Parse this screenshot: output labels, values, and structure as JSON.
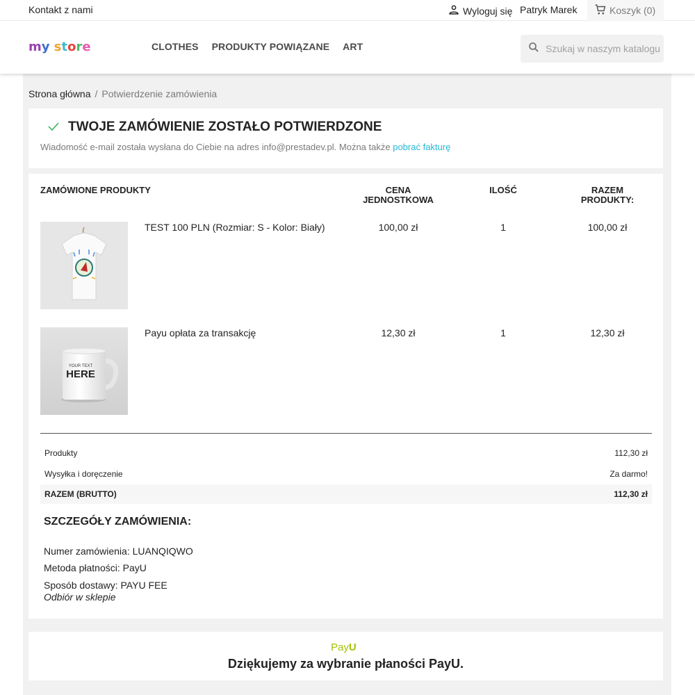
{
  "topbar": {
    "contact": "Kontakt z nami",
    "logout": "Wyloguj się",
    "user": "Patryk Marek",
    "cart": "Koszyk (0)"
  },
  "header": {
    "logo": [
      "m",
      "y",
      " ",
      "s",
      "t",
      "o",
      "r",
      "e"
    ],
    "logo_colors": [
      "#9b3fae",
      "#3c6fce",
      "#ffffff",
      "#f3a331",
      "#3eb8d6",
      "#e4423a",
      "#4cbb6c",
      "#e45ab2"
    ],
    "nav": [
      "CLOTHES",
      "PRODUKTY POWIĄZANE",
      "ART"
    ],
    "search_placeholder": "Szukaj w naszym katalogu"
  },
  "breadcrumb": {
    "home": "Strona główna",
    "separator": "/",
    "current": "Potwierdzenie zamówienia"
  },
  "confirmation": {
    "title": "TWOJE ZAMÓWIENIE ZOSTAŁO POTWIERDZONE",
    "message": "Wiadomość e-mail została wysłana do Ciebie na adres info@prestadev.pl. Można także",
    "invoice_link": "pobrać fakturę"
  },
  "order": {
    "headers": {
      "products": "ZAMÓWIONE PRODUKTY",
      "unit_price_1": "CENA",
      "unit_price_2": "JEDNOSTKOWA",
      "quantity": "ILOŚĆ",
      "total_1": "RAZEM",
      "total_2": "PRODUKTY:"
    },
    "items": [
      {
        "name": "TEST 100 PLN (Rozmiar: S - Kolor: Biały)",
        "price": "100,00 zł",
        "qty": "1",
        "total": "100,00 zł",
        "image": "tshirt-image"
      },
      {
        "name": "Payu opłata za transakcję",
        "price": "12,30 zł",
        "qty": "1",
        "total": "12,30 zł",
        "image": "mug-image"
      }
    ],
    "mug_text_1": "YOUR TEXT",
    "mug_text_2": "HERE",
    "summary": [
      {
        "label": "Produkty",
        "value": "112,30 zł"
      },
      {
        "label": "Wysyłka i doręczenie",
        "value": "Za darmo!"
      },
      {
        "label": "RAZEM (BRUTTO)",
        "value": "112,30 zł"
      }
    ],
    "details_title": "SZCZEGÓŁY ZAMÓWIENIA:",
    "details": {
      "order_number": "Numer zamówienia: LUANQIQWO",
      "payment": "Metoda płatności: PayU",
      "shipping": "Sposób dostawy: PAYU FEE",
      "shipping_note": "Odbiór w sklepie"
    }
  },
  "payu": {
    "logo_1": "Pay",
    "logo_2": "U",
    "thanks": "Dziękujemy za wybranie płaności PayU."
  }
}
